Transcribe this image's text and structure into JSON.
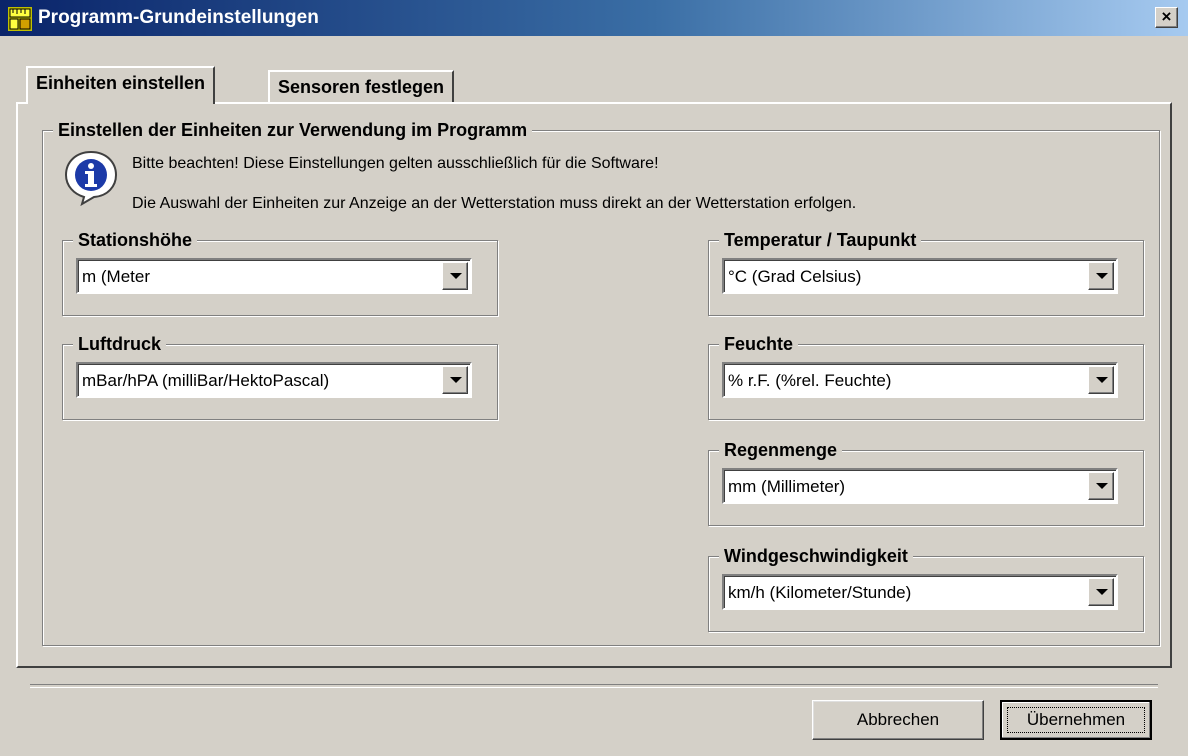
{
  "window": {
    "title": "Programm-Grundeinstellungen",
    "close_symbol": "×"
  },
  "tabs": [
    {
      "label": "Einheiten einstellen",
      "active": true
    },
    {
      "label": "Sensoren festlegen",
      "active": false
    }
  ],
  "units_group": {
    "title": "Einstellen der Einheiten zur Verwendung im Programm",
    "info_line1": "Bitte beachten! Diese Einstellungen gelten ausschließlich für die Software!",
    "info_line2": "Die Auswahl der Einheiten zur Anzeige an der Wetterstation muss direkt an der Wetterstation erfolgen."
  },
  "fields": {
    "station_height": {
      "label": "Stationshöhe",
      "value": "m (Meter"
    },
    "air_pressure": {
      "label": "Luftdruck",
      "value": "mBar/hPA (milliBar/HektoPascal)"
    },
    "temperature": {
      "label": "Temperatur / Taupunkt",
      "value": "°C (Grad Celsius)"
    },
    "humidity": {
      "label": "Feuchte",
      "value": "% r.F. (%rel. Feuchte)"
    },
    "rain": {
      "label": "Regenmenge",
      "value": "mm (Millimeter)"
    },
    "wind": {
      "label": "Windgeschwindigkeit",
      "value": "km/h (Kilometer/Stunde)"
    }
  },
  "buttons": {
    "cancel": "Abbrechen",
    "apply": "Übernehmen"
  },
  "icons": {
    "app": "settings-ruler-icon",
    "info": "info-icon",
    "dropdown": "chevron-down-icon"
  },
  "colors": {
    "titlebar_start": "#0a246a",
    "titlebar_end": "#a6caf0",
    "face": "#d4d0c8"
  }
}
